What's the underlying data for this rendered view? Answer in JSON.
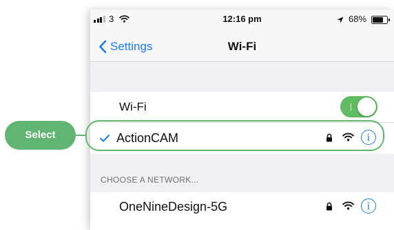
{
  "status_bar": {
    "carrier": "3",
    "time": "12:16 pm",
    "battery_percent": "68%"
  },
  "nav": {
    "back_label": "Settings",
    "title": "Wi-Fi"
  },
  "wifi_toggle": {
    "label": "Wi-Fi",
    "on": true
  },
  "connected_network": {
    "name": "ActionCAM",
    "secured": true,
    "info_glyph": "i"
  },
  "section_header": "CHOOSE A NETWORK...",
  "networks": [
    {
      "name": "OneNineDesign-5G",
      "secured": true,
      "info_glyph": "i"
    }
  ],
  "callout": {
    "label": "Select"
  },
  "colors": {
    "ios_blue": "#1a7cf2",
    "toggle_green": "#5fbc61",
    "callout_green": "#60b572"
  },
  "icons": [
    "signal-bars-icon",
    "wifi-icon",
    "location-arrow-icon",
    "battery-icon",
    "chevron-left-icon",
    "checkmark-icon",
    "lock-icon",
    "info-icon"
  ]
}
